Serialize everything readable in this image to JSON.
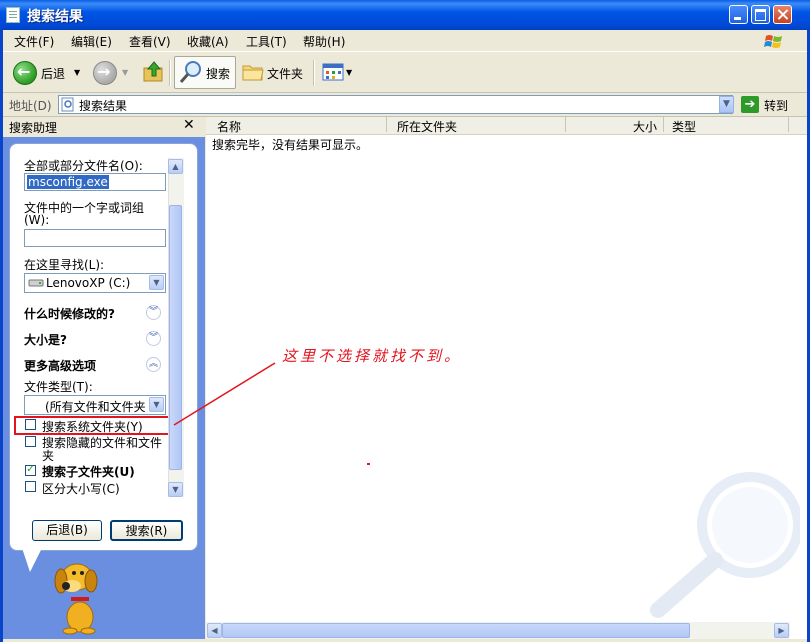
{
  "window": {
    "title": "搜索结果"
  },
  "menu": [
    "文件(F)",
    "编辑(E)",
    "查看(V)",
    "收藏(A)",
    "工具(T)",
    "帮助(H)"
  ],
  "toolbar": {
    "back_label": "后退",
    "search_label": "搜索",
    "folders_label": "文件夹"
  },
  "address": {
    "label": "地址(D)",
    "value": "搜索结果",
    "go_label": "转到"
  },
  "left_pane": {
    "header": "搜索助理",
    "filename_label": "全部或部分文件名(O):",
    "filename_value": "msconfig.exe",
    "word_label_1": "文件中的一个字或词组",
    "word_label_2": "(W):",
    "word_value": "",
    "lookin_label": "在这里寻找(L):",
    "lookin_value": "LenovoXP (C:)",
    "when_modified": "什么时候修改的?",
    "size": "大小是?",
    "advanced": "更多高级选项",
    "filetype_label": "文件类型(T):",
    "filetype_value": "(所有文件和文件夹",
    "opt_system": "搜索系统文件夹(Y)",
    "opt_hidden_1": "搜索隐藏的文件和文件",
    "opt_hidden_2": "夹",
    "opt_subfolders": "搜索子文件夹(U)",
    "opt_case": "区分大小写(C)",
    "back_button": "后退(B)",
    "search_button": "搜索(R)",
    "checks": {
      "system": false,
      "hidden": false,
      "subfolders": true,
      "case": false
    }
  },
  "results": {
    "columns": [
      "名称",
      "所在文件夹",
      "大小",
      "类型"
    ],
    "message": "搜索完毕，没有结果可显示。"
  },
  "annotation": "这里不选择就找不到。",
  "colors": {
    "annotation_red": "#e3141e",
    "title_blue": "#0055e5"
  }
}
